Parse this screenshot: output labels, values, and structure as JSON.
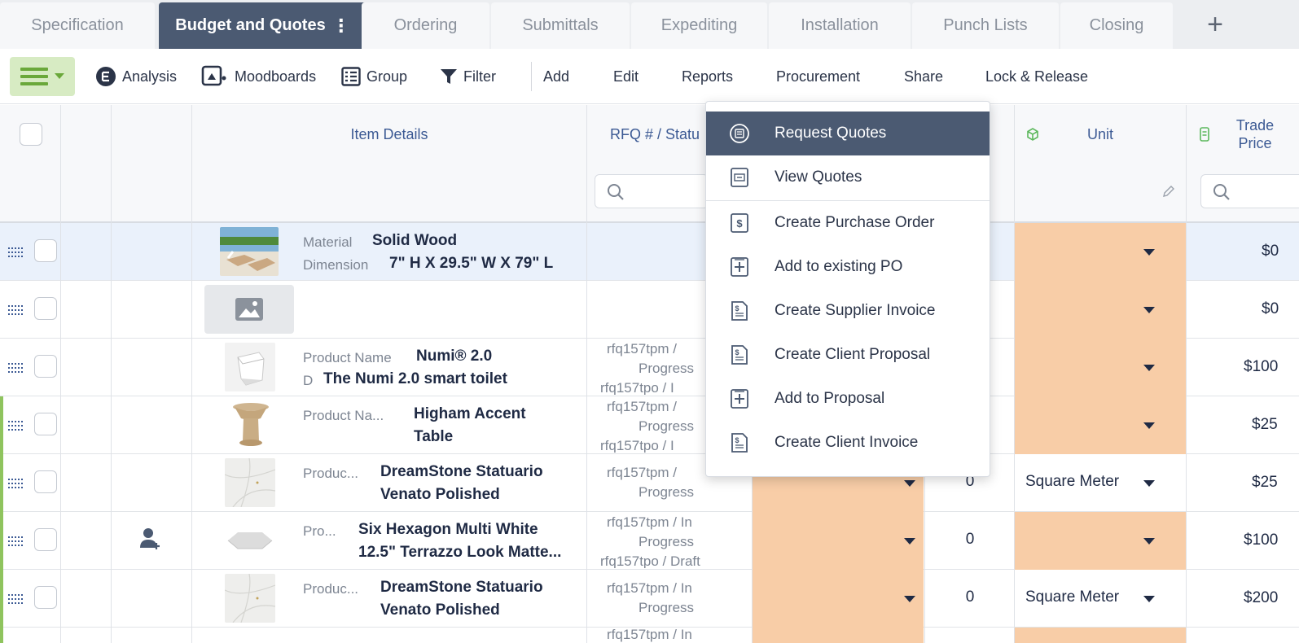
{
  "tabs": [
    {
      "label": "Specification"
    },
    {
      "label": "Budget and Quotes",
      "active": true
    },
    {
      "label": "Ordering"
    },
    {
      "label": "Submittals"
    },
    {
      "label": "Expediting"
    },
    {
      "label": "Installation"
    },
    {
      "label": "Punch Lists"
    },
    {
      "label": "Closing"
    }
  ],
  "toolbar": {
    "analysis": "Analysis",
    "moodboards": "Moodboards",
    "group": "Group",
    "filter": "Filter",
    "add": "Add",
    "edit": "Edit",
    "reports": "Reports",
    "procurement": "Procurement",
    "share": "Share",
    "lock_release": "Lock & Release"
  },
  "columns": {
    "item_details": "Item Details",
    "rfq_status": "RFQ # / Statu",
    "unit": "Unit",
    "trade_price_line1": "Trade",
    "trade_price_line2": "Price"
  },
  "rows": [
    {
      "label1": "Material",
      "value1": "Solid Wood",
      "label2": "Dimension",
      "value2": "7\" H X 29.5\" W X 79\" L",
      "rfq1": "",
      "rfq2": "",
      "rfq3": "",
      "qty": "",
      "unit": "",
      "price": "$0"
    },
    {
      "label1": "",
      "value1": "",
      "label2": "",
      "value2": "",
      "rfq1": "",
      "rfq2": "",
      "rfq3": "",
      "qty": "",
      "unit": "",
      "price": "$0"
    },
    {
      "label1": "Product Name",
      "value1": "Numi® 2.0",
      "label2": "D",
      "value2": "The Numi 2.0 smart toilet",
      "rfq1": "rfq157tpm  /",
      "rfq2": "Progress",
      "rfq3": "rfq157tpo  /  I",
      "qty": "",
      "unit": "",
      "price": "$100"
    },
    {
      "label1": "Product Na...",
      "value1": "Higham Accent",
      "label2": "",
      "value2": "Table",
      "rfq1": "rfq157tpm  /",
      "rfq2": "Progress",
      "rfq3": "rfq157tpo  /  I",
      "qty": "",
      "unit": "",
      "price": "$25"
    },
    {
      "label1": "Produc...",
      "value1": "DreamStone Statuario",
      "label2": "",
      "value2": "Venato Polished",
      "rfq1": "rfq157tpm  /",
      "rfq2": "Progress",
      "rfq3": "",
      "qty": "0",
      "unit": "Square Meter",
      "price": "$25"
    },
    {
      "label1": "Pro...",
      "value1": "Six Hexagon Multi White",
      "label2": "",
      "value2": "12.5\" Terrazzo Look Matte...",
      "rfq1": "rfq157tpm  /  In",
      "rfq2": "Progress",
      "rfq3": "rfq157tpo  /  Draft",
      "qty": "0",
      "unit": "",
      "price": "$100"
    },
    {
      "label1": "Produc...",
      "value1": "DreamStone Statuario",
      "label2": "",
      "value2": "Venato Polished",
      "rfq1": "rfq157tpm  /  In",
      "rfq2": "Progress",
      "rfq3": "",
      "qty": "0",
      "unit": "Square Meter",
      "price": "$200"
    }
  ],
  "last_row_rfq": "rfq157tpm  /  In",
  "dropdown": {
    "items": [
      {
        "label": "Request Quotes",
        "icon": "request-quotes-icon"
      },
      {
        "label": "View Quotes",
        "icon": "view-quotes-icon"
      },
      {
        "label": "Create Purchase Order",
        "icon": "purchase-order-icon"
      },
      {
        "label": "Add to existing PO",
        "icon": "add-to-po-icon"
      },
      {
        "label": "Create Supplier Invoice",
        "icon": "supplier-invoice-icon"
      },
      {
        "label": "Create Client Proposal",
        "icon": "client-proposal-icon"
      },
      {
        "label": "Add to Proposal",
        "icon": "add-to-proposal-icon"
      },
      {
        "label": "Create Client Invoice",
        "icon": "client-invoice-icon"
      }
    ]
  },
  "colors": {
    "active_tab": "#4b5a72",
    "header_text": "#3c5a94",
    "cell_orange": "#f8cda7",
    "group_green": "#8fc45e",
    "menu_button": "#d7ebc3"
  }
}
